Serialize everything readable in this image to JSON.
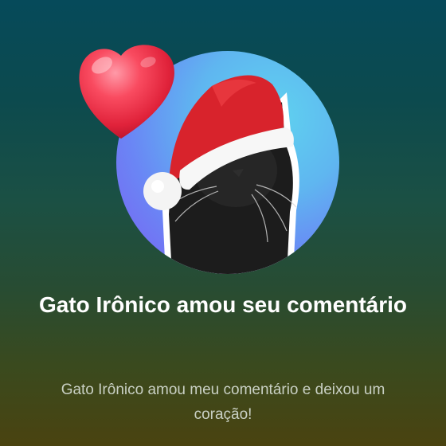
{
  "notification": {
    "title": "Gato Irônico  amou seu comentário",
    "message": "Gato Irônico  amou meu comentário e deixou um coração!",
    "avatar_icon": "black-cat-santa-hat-avatar",
    "reaction_icon": "heart-icon",
    "colors": {
      "heart": "#f2394f",
      "avatar_gradient_start": "#5fd3ef",
      "avatar_gradient_end": "#7d5bf2",
      "title_text": "#ffffff",
      "message_text": "#c9d0c4"
    }
  }
}
